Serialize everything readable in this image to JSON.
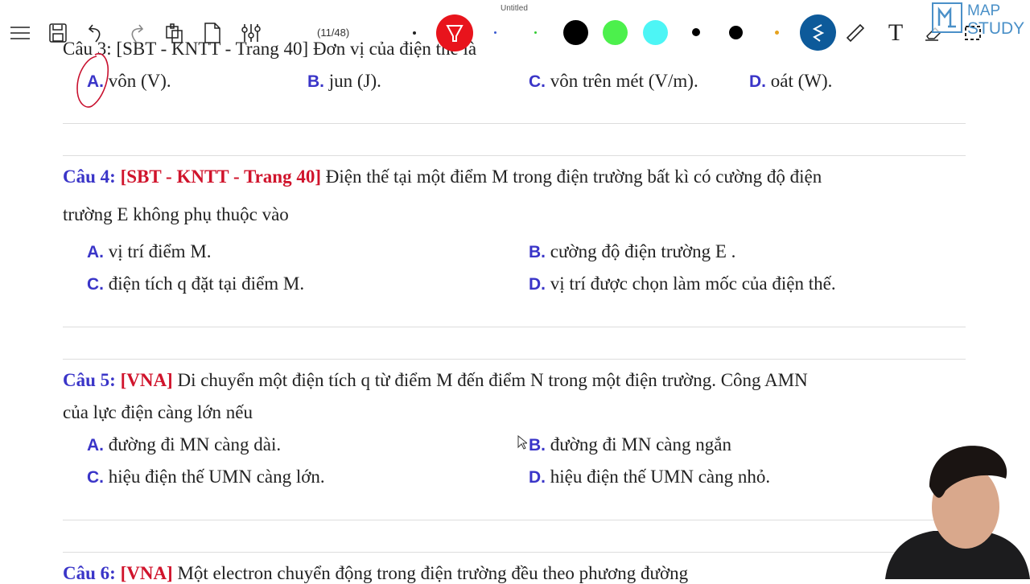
{
  "toolbar": {
    "title": "Untitled",
    "page_indicator": "(11/48)",
    "colors": [
      "#000000",
      "#4cf04c",
      "#4df5f5",
      "#000000",
      "#000000",
      "#e6a21e"
    ],
    "pen_active_color": "#e8141c",
    "stroke_tool_color": "#0d5a9a",
    "logo": {
      "line1": "MAP",
      "line2": "STUDY"
    }
  },
  "q3": {
    "partial": "Câu 3: [SBT - KNTT - Trang 40] Đơn vị của điện thế là",
    "options": [
      {
        "l": "A.",
        "t": "vôn (V)."
      },
      {
        "l": "B.",
        "t": "jun (J)."
      },
      {
        "l": "C.",
        "t": "vôn trên mét (V/m)."
      },
      {
        "l": "D.",
        "t": "oát (W)."
      }
    ]
  },
  "q4": {
    "label": "Câu 4:",
    "source": "[SBT - KNTT - Trang 40]",
    "text1": "Điện thế tại một điểm M trong điện trường bất kì có cường độ điện",
    "text2": "trường E không phụ thuộc vào",
    "options": [
      {
        "l": "A.",
        "t": "vị trí điểm M."
      },
      {
        "l": "B.",
        "t": "cường độ điện trường E ."
      },
      {
        "l": "C.",
        "t": "điện tích q đặt tại điểm M."
      },
      {
        "l": "D.",
        "t": "vị trí được chọn làm mốc của điện thế."
      }
    ]
  },
  "q5": {
    "label": "Câu 5:",
    "source": "[VNA]",
    "text1": "Di chuyển một điện tích q từ điểm M đến điểm N trong một điện trường. Công AMN",
    "text2": "của lực điện càng lớn nếu",
    "options": [
      {
        "l": "A.",
        "t": "đường đi MN càng dài."
      },
      {
        "l": "B.",
        "t": "đường đi MN càng ngắn"
      },
      {
        "l": "C.",
        "t": "hiệu điện thế UMN càng lớn."
      },
      {
        "l": "D.",
        "t": "hiệu điện thế UMN càng nhỏ."
      }
    ]
  },
  "q6": {
    "label": "Câu 6:",
    "source": "[VNA]",
    "text": "Một electron chuyển động trong điện trường đều theo phương đường"
  }
}
